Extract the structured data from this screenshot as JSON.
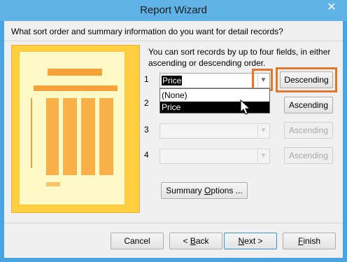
{
  "window": {
    "title": "Report Wizard",
    "close": "✕"
  },
  "question": "What sort order and summary information do you want for detail records?",
  "instructions": "You can sort records by up to four fields, in either ascending or descending order.",
  "sort_rows": [
    {
      "num": "1",
      "value": "Price",
      "order": "Descending",
      "enabled": true
    },
    {
      "num": "2",
      "value": "",
      "order": "Ascending",
      "enabled": true
    },
    {
      "num": "3",
      "value": "",
      "order": "Ascending",
      "enabled": false
    },
    {
      "num": "4",
      "value": "",
      "order": "Ascending",
      "enabled": false
    }
  ],
  "dropdown_options": [
    "(None)",
    "Price"
  ],
  "dropdown_selected": "Price",
  "summary_button": {
    "pre": "Summary ",
    "key": "O",
    "post": "ptions ..."
  },
  "footer": {
    "cancel": "Cancel",
    "back": {
      "pre": "< ",
      "key": "B",
      "post": "ack"
    },
    "next": {
      "pre": "",
      "key": "N",
      "post": "ext >"
    },
    "finish": {
      "pre": "",
      "key": "F",
      "post": "inish"
    }
  },
  "colors": {
    "highlight": "#e4772c",
    "titlebar": "#5fb2e6",
    "illustration": "#ffcf3f"
  }
}
